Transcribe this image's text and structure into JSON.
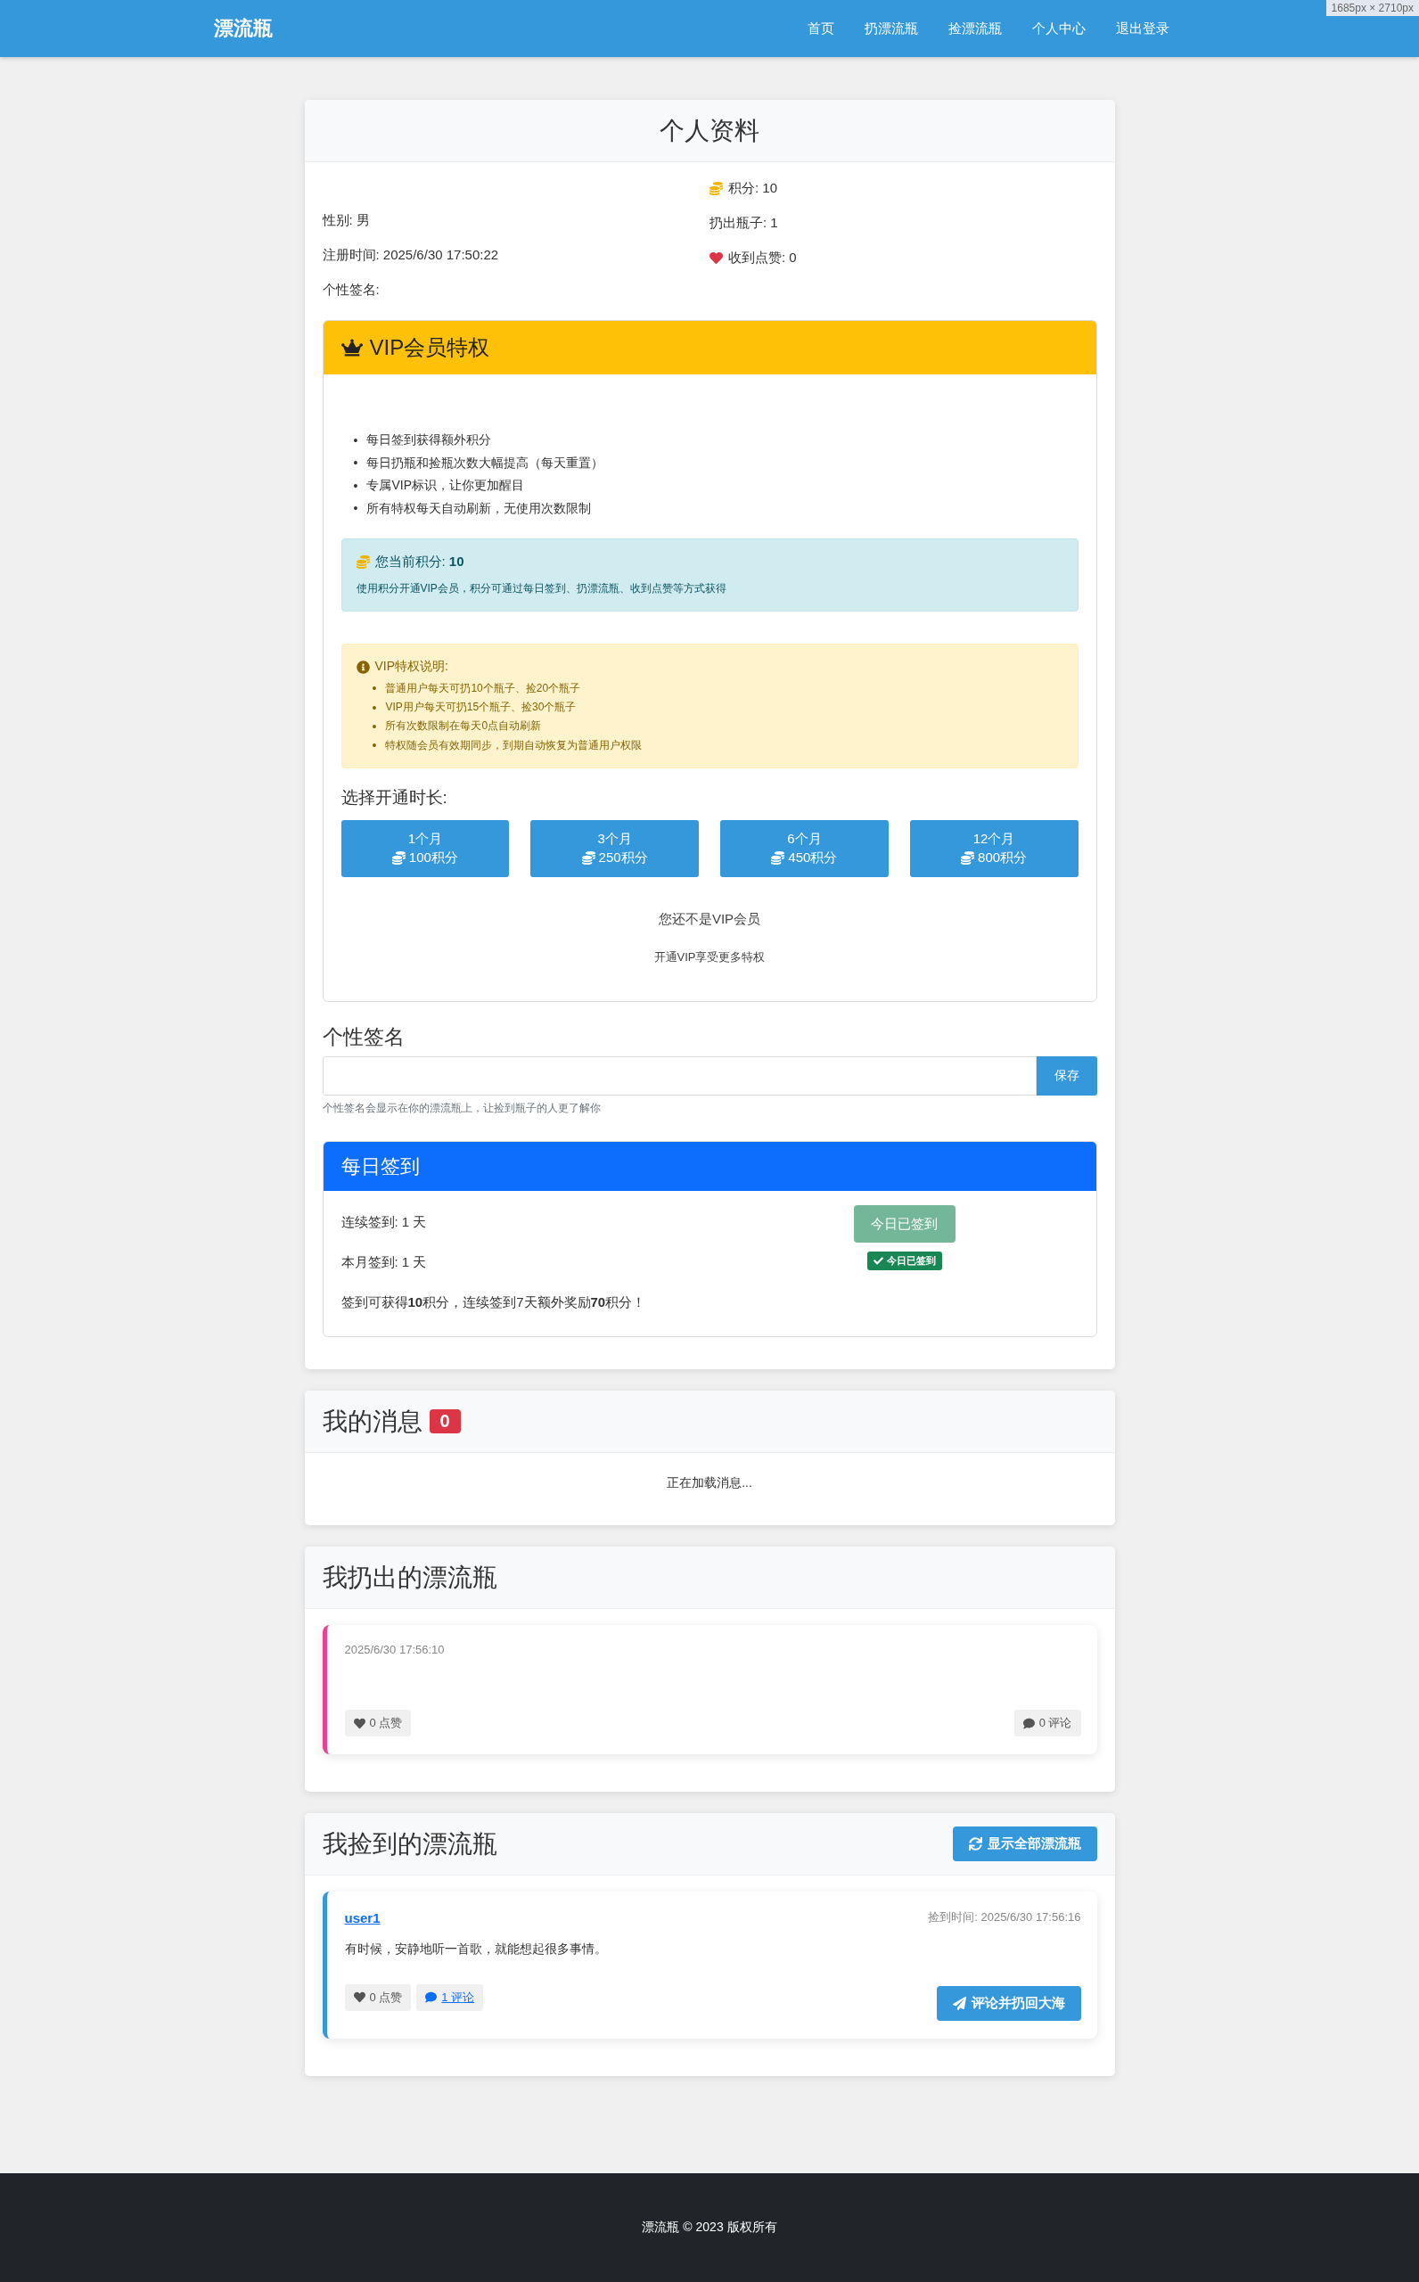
{
  "overlay": "1685px × 2710px",
  "navbar": {
    "brand": "漂流瓶",
    "links": [
      {
        "label": "首页"
      },
      {
        "label": "扔漂流瓶"
      },
      {
        "label": "捡漂流瓶"
      },
      {
        "label": "个人中心"
      },
      {
        "label": "退出登录"
      }
    ]
  },
  "profile": {
    "title": "个人资料",
    "left": [
      "性别: 男",
      "注册时间: 2025/6/30 17:50:22",
      "个性签名:"
    ],
    "right": [
      {
        "kind": "points",
        "text": "积分: 10"
      },
      {
        "kind": "plain",
        "text": "扔出瓶子: 1"
      },
      {
        "kind": "likes",
        "text": "收到点赞: 0"
      }
    ]
  },
  "vip": {
    "title": "VIP会员特权",
    "bullet": "•",
    "benefits": [
      "每日签到获得额外积分",
      "每日扔瓶和捡瓶次数大幅提高（每天重置）",
      "专属VIP标识，让你更加醒目",
      "所有特权每天自动刷新，无使用次数限制"
    ],
    "points_box": {
      "label": "您当前积分: **10**",
      "note": "使用积分开通VIP会员，积分可通过每日签到、扔漂流瓶、收到点赞等方式获得"
    },
    "rules": {
      "title": "VIP特权说明:",
      "items": [
        "普通用户每天可扔10个瓶子、捡20个瓶子",
        "VIP用户每天可扔15个瓶子、捡30个瓶子",
        "所有次数限制在每天0点自动刷新",
        "特权随会员有效期同步，到期自动恢复为普通用户权限"
      ]
    },
    "duration_label": "选择开通时长:",
    "plans": [
      {
        "months": "1个月",
        "cost": "100积分"
      },
      {
        "months": "3个月",
        "cost": "250积分"
      },
      {
        "months": "6个月",
        "cost": "450积分"
      },
      {
        "months": "12个月",
        "cost": "800积分"
      }
    ],
    "status": "您还不是VIP会员",
    "hint": "开通VIP享受更多特权"
  },
  "signature": {
    "heading": "个性签名",
    "save": "保存",
    "help": "个性签名会显示在你的漂流瓶上，让捡到瓶子的人更了解你"
  },
  "checkin": {
    "title": "每日签到",
    "streak": "连续签到: 1 天",
    "month": "本月签到: 1 天",
    "reward": "签到可获得**10**积分，连续签到7天额外奖励**70**积分！",
    "button": "今日已签到",
    "badge": "今日已签到",
    "checked_in": true
  },
  "messages": {
    "title": "我的消息",
    "count": "0",
    "status": "正在加载消息..."
  },
  "thrown": {
    "title": "我扔出的漂流瓶",
    "bottles": [
      {
        "time": "2025/6/30 17:56:10",
        "likes": "0 点赞",
        "comments": "0 评论"
      }
    ]
  },
  "picked": {
    "title": "我捡到的漂流瓶",
    "show_all": "显示全部漂流瓶",
    "bottles": [
      {
        "user": "user1",
        "time": "捡到时间: 2025/6/30 17:56:16",
        "text": "有时候，安静地听一首歌，就能想起很多事情。",
        "likes": "0 点赞",
        "comments": "1 评论",
        "action": "评论并扔回大海"
      }
    ]
  },
  "footer": "漂流瓶 © 2023 版权所有"
}
